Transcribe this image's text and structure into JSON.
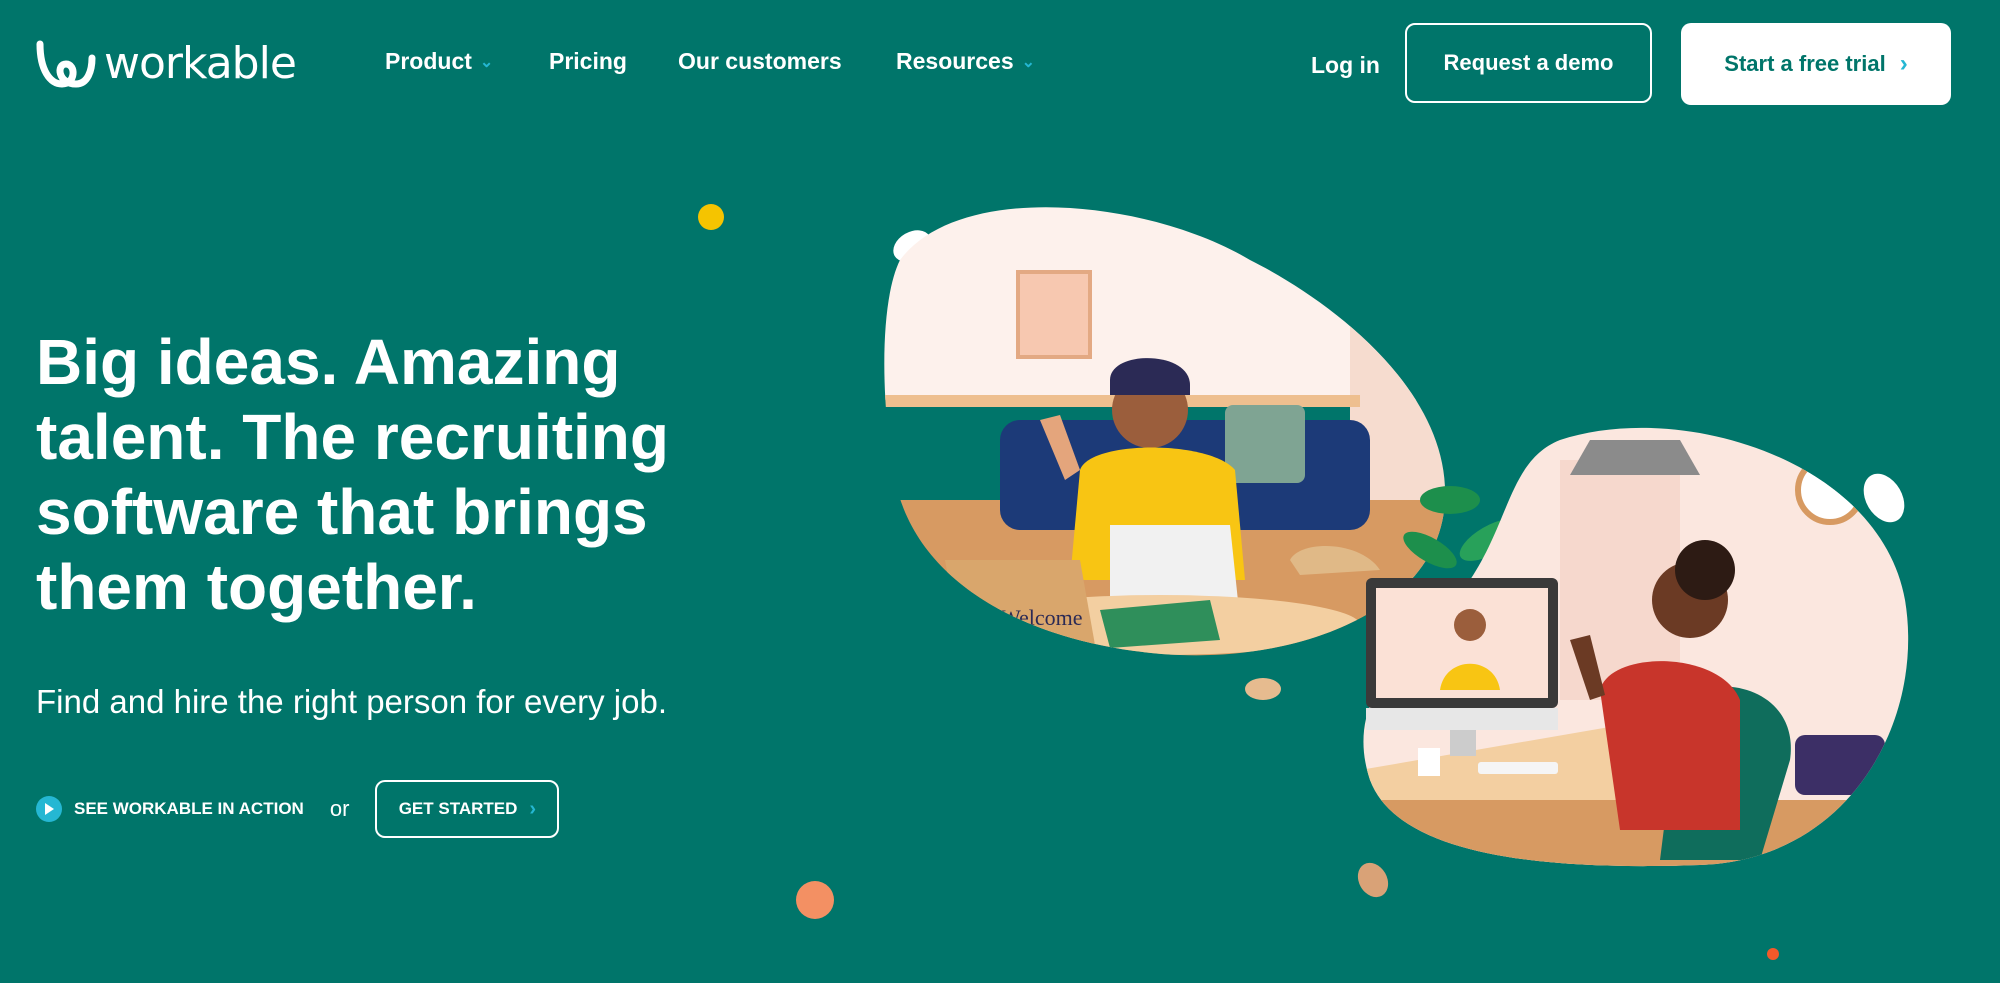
{
  "brand": {
    "name": "workable"
  },
  "nav": {
    "items": [
      {
        "label": "Product",
        "has_dropdown": true
      },
      {
        "label": "Pricing",
        "has_dropdown": false
      },
      {
        "label": "Our customers",
        "has_dropdown": false
      },
      {
        "label": "Resources",
        "has_dropdown": true
      }
    ],
    "login": "Log in",
    "request_demo": "Request a demo",
    "free_trial": "Start a free trial"
  },
  "hero": {
    "title": "Big ideas. Amazing talent. The recruiting software that brings them together.",
    "subtitle": "Find and hire the right person for every job.",
    "see_action": "SEE WORKABLE IN ACTION",
    "or": "or",
    "get_started": "GET STARTED",
    "illustration_box_text": "Welcome"
  },
  "colors": {
    "background": "#00756a",
    "accent": "#25b7d3",
    "yellow_dot": "#f5c400",
    "orange_dot": "#f39063"
  }
}
